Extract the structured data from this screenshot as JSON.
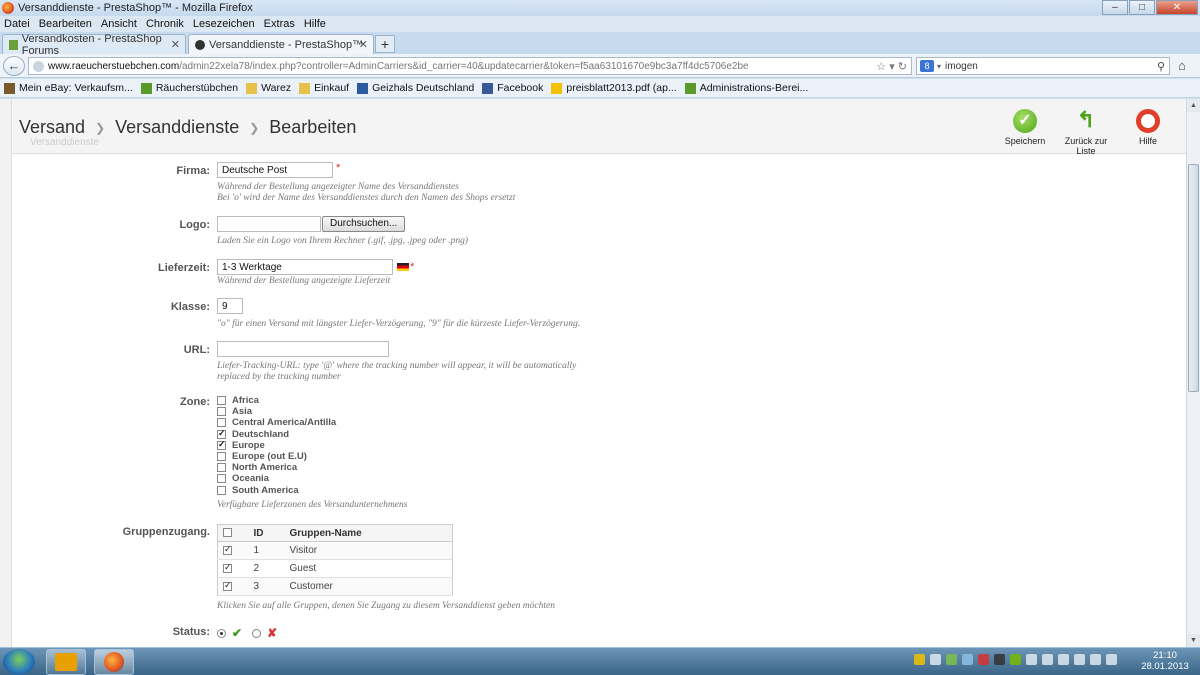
{
  "window": {
    "title": "Versanddienste - PrestaShop™ - Mozilla Firefox",
    "controls": [
      "–",
      "□",
      "✕"
    ]
  },
  "menu": [
    "Datei",
    "Bearbeiten",
    "Ansicht",
    "Chronik",
    "Lesezeichen",
    "Extras",
    "Hilfe"
  ],
  "tabs": [
    {
      "label": "Versandkosten - PrestaShop Forums",
      "active": false
    },
    {
      "label": "Versanddienste - PrestaShop™",
      "active": true
    }
  ],
  "nav": {
    "url_host": "www.raeucherstuebchen.com",
    "url_path": "/admin22xela78/index.php?controller=AdminCarriers&id_carrier=40&updatecarrier&token=f5aa63101670e9bc3a7ff4dc5706e2be",
    "search_engine": "8",
    "search_value": "imogen"
  },
  "bookmarks": [
    {
      "label": "Mein eBay: Verkaufsm...",
      "icon": "briefcase-icon",
      "color": "#7a5a2a"
    },
    {
      "label": "Räucherstübchen",
      "icon": "leaf-icon",
      "color": "#5a9a2a"
    },
    {
      "label": "Warez",
      "icon": "folder-icon",
      "color": "#e8c14a"
    },
    {
      "label": "Einkauf",
      "icon": "folder-icon",
      "color": "#e8c14a"
    },
    {
      "label": "Geizhals Deutschland",
      "icon": "geizhals-icon",
      "color": "#2a5aa0"
    },
    {
      "label": "Facebook",
      "icon": "facebook-icon",
      "color": "#3b5998"
    },
    {
      "label": "preisblatt2013.pdf (ap...",
      "icon": "post-icon",
      "color": "#f2c200"
    },
    {
      "label": "Administrations-Berei...",
      "icon": "leaf-icon",
      "color": "#5a9a2a"
    }
  ],
  "header": {
    "breadcrumb": [
      "Versand",
      "Versanddienste",
      "Bearbeiten"
    ],
    "ghost_title": "Versanddienste",
    "toolbar": {
      "save": "Speichern",
      "back": "Zurück zur Liste",
      "help": "Hilfe"
    }
  },
  "form": {
    "firma": {
      "label": "Firma:",
      "value": "Deutsche Post",
      "hint1": "Während der Bestellung angezeigter Name des Versanddienstes",
      "hint2": "Bei 'o' wird der Name des Versanddienstes durch den Namen des Shops ersetzt"
    },
    "logo": {
      "label": "Logo:",
      "button": "Durchsuchen...",
      "hint": "Laden Sie ein Logo von Ihrem Rechner (.gif, .jpg, .jpeg oder .png)"
    },
    "lieferzeit": {
      "label": "Lieferzeit:",
      "value": "1-3 Werktage",
      "hint": "Während der Bestellung angezeigte Lieferzeit"
    },
    "klasse": {
      "label": "Klasse:",
      "value": "9",
      "hint": "\"o\" für einen Versand mit längster Liefer-Verzögerung, \"9\" für die kürzeste Liefer-Verzögerung."
    },
    "url": {
      "label": "URL:",
      "value": "",
      "hint1": "Liefer-Tracking-URL: type '@' where the tracking number will appear, it will be automatically",
      "hint2": "replaced by the tracking number"
    },
    "zone": {
      "label": "Zone:",
      "items": [
        {
          "name": "Africa",
          "checked": false
        },
        {
          "name": "Asia",
          "checked": false
        },
        {
          "name": "Central America/Antilla",
          "checked": false
        },
        {
          "name": "Deutschland",
          "checked": true
        },
        {
          "name": "Europe",
          "checked": true
        },
        {
          "name": "Europe (out E.U)",
          "checked": false
        },
        {
          "name": "North America",
          "checked": false
        },
        {
          "name": "Oceania",
          "checked": false
        },
        {
          "name": "South America",
          "checked": false
        }
      ],
      "hint": "Verfügbare Lieferzonen des Versandunternehmens"
    },
    "gruppen": {
      "label": "Gruppenzugang.",
      "col_id": "ID",
      "col_name": "Gruppen-Name",
      "rows": [
        {
          "id": "1",
          "name": "Visitor",
          "checked": true
        },
        {
          "id": "2",
          "name": "Guest",
          "checked": true
        },
        {
          "id": "3",
          "name": "Customer",
          "checked": true
        }
      ],
      "hint": "Klicken Sie auf alle Gruppen, denen Sie Zugang zu diesem Versanddienst geben möchten"
    },
    "status": {
      "label": "Status:",
      "selected": "enabled"
    }
  },
  "taskbar": {
    "time": "21:10",
    "date": "28.01.2013"
  }
}
